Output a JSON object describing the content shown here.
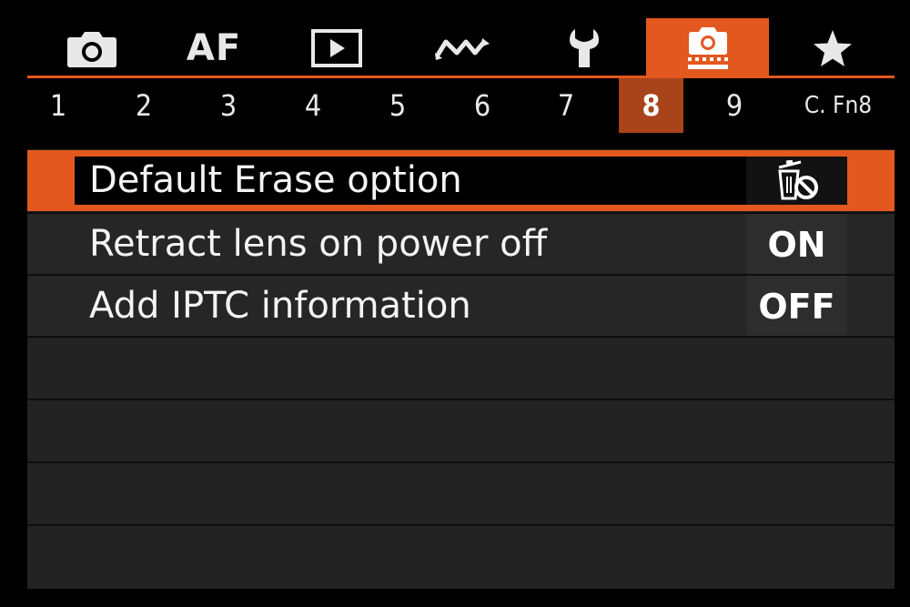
{
  "tabs": [
    {
      "name": "shooting-tab",
      "icon": "camera-icon",
      "label": ""
    },
    {
      "name": "af-tab",
      "icon": "",
      "label": "AF"
    },
    {
      "name": "playback-tab",
      "icon": "play-icon",
      "label": ""
    },
    {
      "name": "wireless-tab",
      "icon": "wireless-icon",
      "label": ""
    },
    {
      "name": "setup-tab",
      "icon": "wrench-icon",
      "label": ""
    },
    {
      "name": "custom-functions-tab",
      "icon": "custom-camera-icon",
      "label": "",
      "active": true
    },
    {
      "name": "my-menu-tab",
      "icon": "star-icon",
      "label": ""
    }
  ],
  "pages": [
    "1",
    "2",
    "3",
    "4",
    "5",
    "6",
    "7",
    "8",
    "9",
    "C. Fn8"
  ],
  "active_page": "8",
  "items": [
    {
      "label": "Default Erase option",
      "value": "",
      "value_icon": "erase-cancel-icon",
      "selected": true
    },
    {
      "label": "Retract lens on power off",
      "value": "ON"
    },
    {
      "label": "Add IPTC information",
      "value": "OFF"
    }
  ],
  "colors": {
    "accent": "#e2581e",
    "active_page_bg": "#a8431a",
    "background": "#1f1f1f"
  }
}
